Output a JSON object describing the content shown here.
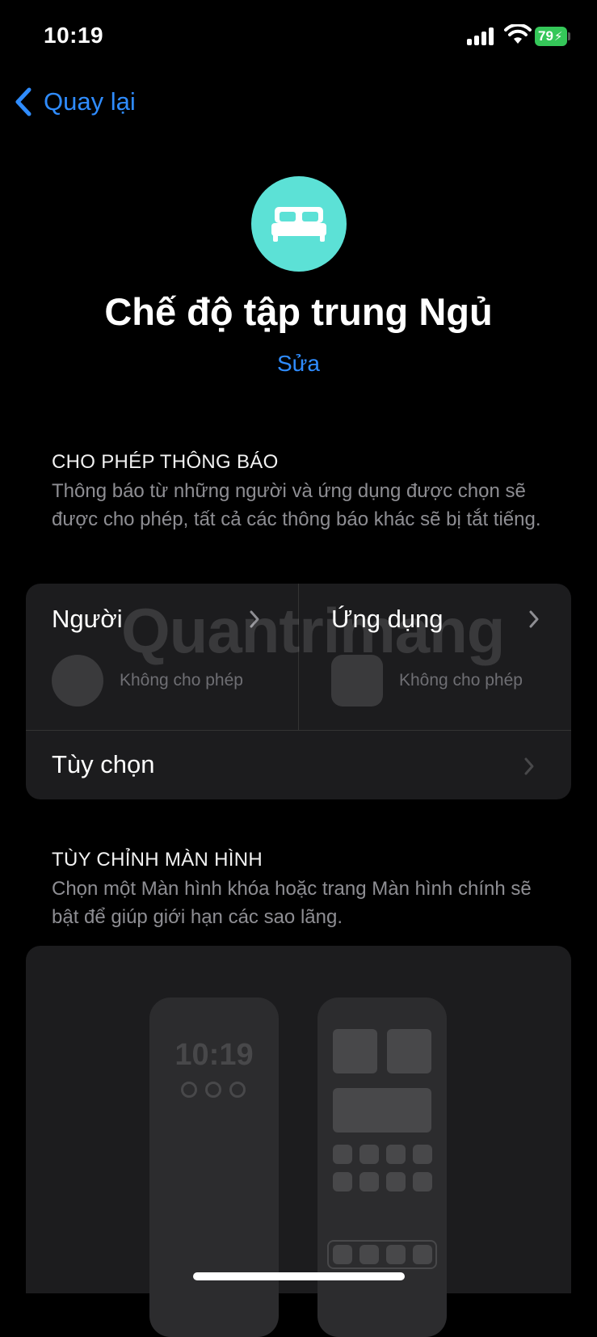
{
  "status_bar": {
    "time": "10:19",
    "battery": "79"
  },
  "nav": {
    "back_label": "Quay lại"
  },
  "header": {
    "title": "Chế độ tập trung Ngủ",
    "edit_label": "Sửa",
    "icon": "bed-icon",
    "icon_color": "#5ce1d6"
  },
  "allow_notifications": {
    "heading": "CHO PHÉP THÔNG BÁO",
    "description": "Thông báo từ những người và ứng dụng được chọn sẽ được cho phép, tất cả các thông báo khác sẽ bị tắt tiếng.",
    "people": {
      "label": "Người",
      "status": "Không cho phép"
    },
    "apps": {
      "label": "Ứng dụng",
      "status": "Không cho phép"
    },
    "options": {
      "label": "Tùy chọn"
    }
  },
  "customize_screens": {
    "heading": "TÙY CHỈNH MÀN HÌNH",
    "description": "Chọn một Màn hình khóa hoặc trang Màn hình chính sẽ bật để giúp giới hạn các sao lãng.",
    "lock_screen_time": "10:19"
  },
  "watermark": "Quantrimang",
  "colors": {
    "accent": "#2f8cff",
    "background": "#000000",
    "card": "#1c1c1e",
    "battery": "#35c759"
  }
}
